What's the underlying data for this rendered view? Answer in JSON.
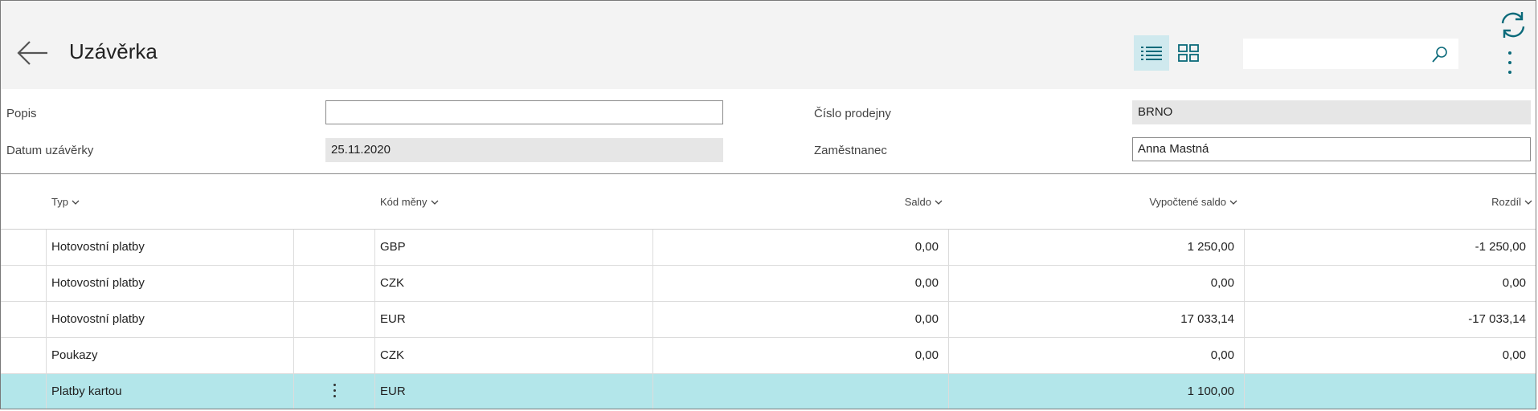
{
  "header": {
    "title": "Uzávěrka",
    "search_placeholder": "",
    "accent_color": "#0b6a7a"
  },
  "icons": {
    "back": "back-arrow-icon",
    "list_view": "list-view-icon",
    "tile_view": "tile-view-icon",
    "search": "search-icon",
    "refresh": "refresh-icon",
    "more": "more-vertical-icon"
  },
  "form": {
    "popis_label": "Popis",
    "popis_value": "",
    "datum_label": "Datum uzávěrky",
    "datum_value": "25.11.2020",
    "prodejna_label": "Číslo prodejny",
    "prodejna_value": "BRNO",
    "zamestnanec_label": "Zaměstnanec",
    "zamestnanec_value": "Anna Mastná"
  },
  "table": {
    "columns": {
      "typ": "Typ",
      "kod_meny": "Kód měny",
      "saldo": "Saldo",
      "vypoctene_saldo": "Vypočtené saldo",
      "rozdil": "Rozdíl"
    },
    "rows": [
      {
        "typ": "Hotovostní platby",
        "kod_meny": "GBP",
        "saldo": "0,00",
        "vypoctene_saldo": "1 250,00",
        "rozdil": "-1 250,00"
      },
      {
        "typ": "Hotovostní platby",
        "kod_meny": "CZK",
        "saldo": "0,00",
        "vypoctene_saldo": "0,00",
        "rozdil": "0,00"
      },
      {
        "typ": "Hotovostní platby",
        "kod_meny": "EUR",
        "saldo": "0,00",
        "vypoctene_saldo": "17 033,14",
        "rozdil": "-17 033,14"
      },
      {
        "typ": "Poukazy",
        "kod_meny": "CZK",
        "saldo": "0,00",
        "vypoctene_saldo": "0,00",
        "rozdil": "0,00"
      },
      {
        "typ": "Platby kartou",
        "kod_meny": "EUR",
        "saldo": "",
        "vypoctene_saldo": "1 100,00",
        "rozdil": ""
      }
    ],
    "selected_row_color": "#b3e6ea"
  }
}
